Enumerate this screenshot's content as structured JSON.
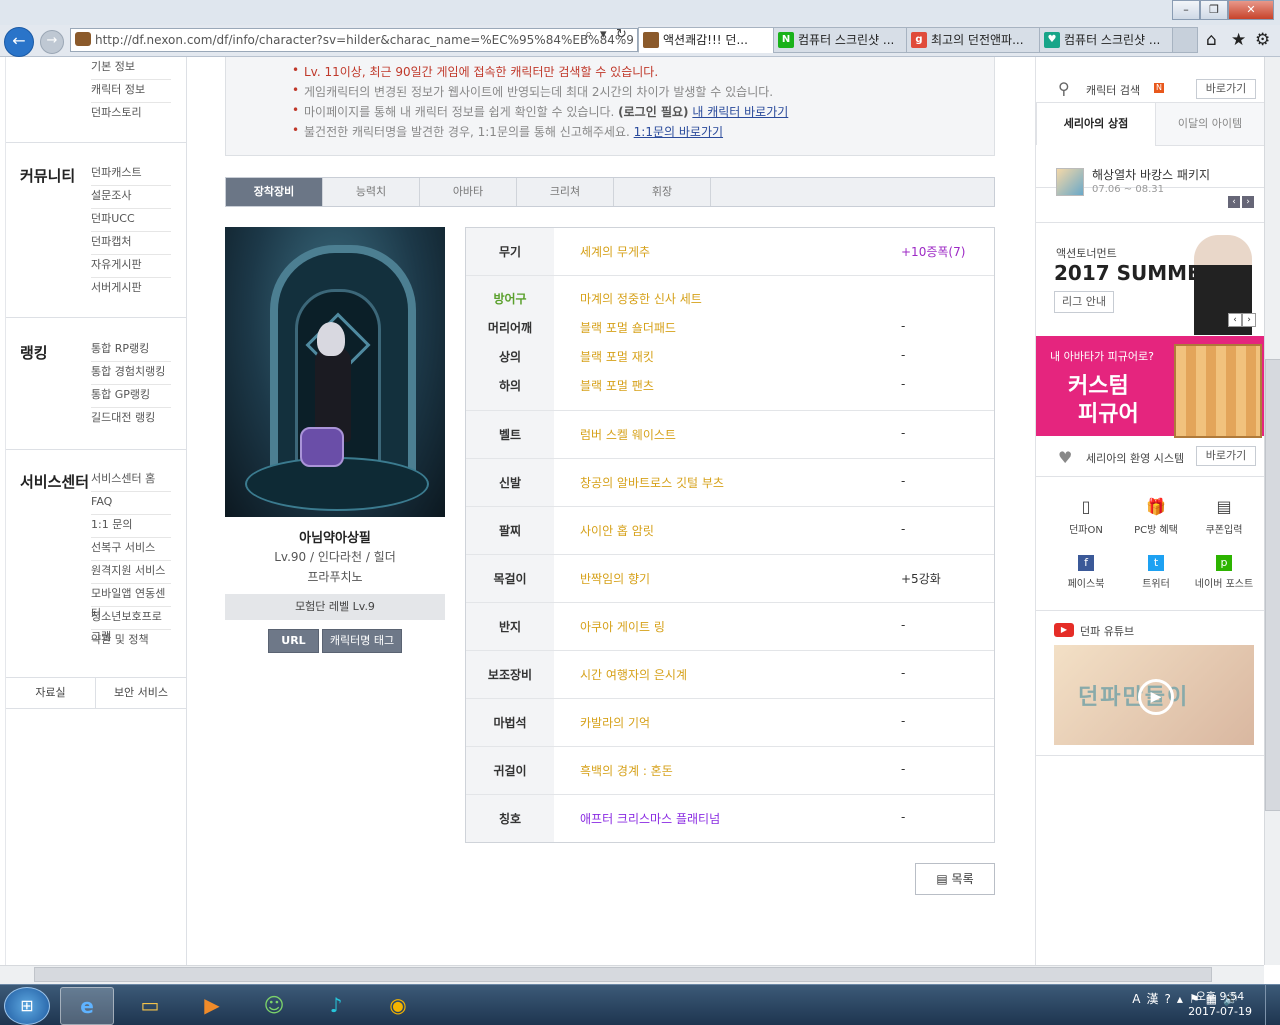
{
  "browser": {
    "address": "http://df.nexon.com/df/info/character?sv=hilder&charac_name=%EC%95%84%EB%84%9",
    "address_domain": "df.nexon.com",
    "tabs": [
      {
        "label": "액션쾌감!!! 던...",
        "icon_color": "#8b5a2b"
      },
      {
        "label": "컴퓨터 스크린샷 ...",
        "icon_color": "#19b21a",
        "icon_text": "N"
      },
      {
        "label": "최고의 던전앤파...",
        "icon_color": "#e04b3a",
        "icon_text": "g"
      },
      {
        "label": "컴퓨터 스크린샷 ...",
        "icon_color": "#17a589",
        "icon_text": "♥"
      }
    ]
  },
  "left_nav": {
    "top_links": [
      "기본 정보",
      "캐릭터 정보",
      "던파스토리"
    ],
    "groups": [
      {
        "title": "커뮤니티",
        "links": [
          "던파캐스트",
          "설문조사",
          "던파UCC",
          "던파캡처",
          "자유게시판",
          "서버게시판"
        ]
      },
      {
        "title": "랭킹",
        "links": [
          "통합 RP랭킹",
          "통합 경험치랭킹",
          "통합 GP랭킹",
          "길드대전 랭킹"
        ]
      },
      {
        "title": "서비스센터",
        "links": [
          "서비스센터 홈",
          "FAQ",
          "1:1 문의",
          "선복구 서비스",
          "원격지원 서비스",
          "모바일앱 연동센터",
          "청소년보호프로그램",
          "약관 및 정책"
        ]
      }
    ],
    "bottom": [
      "자료실",
      "보안 서비스"
    ]
  },
  "notice": {
    "line1": "Lv. 11이상, 최근 90일간 게임에 접속한 캐릭터만 검색할 수 있습니다.",
    "line2": "게임캐릭터의 변경된 정보가 웹사이트에 반영되는데 최대 2시간의 차이가 발생할 수 있습니다.",
    "line3_pre": "마이페이지를 통해 내 캐릭터 정보를 쉽게 확인할 수 있습니다. ",
    "line3_bold": "(로그인 필요)",
    "line3_link": "내 캐릭터 바로가기",
    "line4_pre": "불건전한 캐릭터명을 발견한 경우, 1:1문의를 통해 신고해주세요. ",
    "line4_link": "1:1문의 바로가기"
  },
  "char_tabs": [
    "장착장비",
    "능력치",
    "아바타",
    "크리쳐",
    "휘장"
  ],
  "character": {
    "name": "아님약아상필",
    "info": "Lv.90 / 인다라천 / 힐더",
    "guild": "프라푸치노",
    "adventure_level": "모험단 레벨 Lv.9",
    "btn_url": "URL",
    "btn_tag": "캐릭터명 태그"
  },
  "equipment": [
    {
      "slot": "무기",
      "item": "세계의 무게추",
      "opt": "+10증폭(7)",
      "opt_purple": true
    },
    {
      "slot": "방어구",
      "slot_green": true,
      "item": "마계의 정중한 신사 세트",
      "opt": ""
    },
    {
      "slot": "머리어깨",
      "item": "블랙 포멀 숄더패드",
      "opt": "-"
    },
    {
      "slot": "상의",
      "item": "블랙 포멀 재킷",
      "opt": "-"
    },
    {
      "slot": "하의",
      "item": "블랙 포멀 팬츠",
      "opt": "-"
    },
    {
      "slot": "벨트",
      "item": "럼버 스켈 웨이스트",
      "opt": "-"
    },
    {
      "slot": "신발",
      "item": "창공의 알바트로스 깃털 부츠",
      "opt": "-"
    },
    {
      "slot": "팔찌",
      "item": "사이안 홉 암릿",
      "opt": "-"
    },
    {
      "slot": "목걸이",
      "item": "반짝임의 향기",
      "opt": "+5강화"
    },
    {
      "slot": "반지",
      "item": "아쿠아 게이트 링",
      "opt": "-"
    },
    {
      "slot": "보조장비",
      "item": "시간 여행자의 은시계",
      "opt": "-"
    },
    {
      "slot": "마법석",
      "item": "카발라의 기억",
      "opt": "-"
    },
    {
      "slot": "귀걸이",
      "item": "흑백의 경계 : 혼돈",
      "opt": "-"
    },
    {
      "slot": "칭호",
      "item": "애프터 크리스마스 플래티넘",
      "opt": "-",
      "item_purple": true
    }
  ],
  "list_button": "목록",
  "right": {
    "char_search": "캐릭터 검색",
    "char_search_badge": "N",
    "go": "바로가기",
    "tab_active": "세리아의 상점",
    "tab_inactive": "이달의 아이템",
    "promo_title": "해상열차 바캉스 패키지",
    "promo_date": "07.06 ~ 08.31",
    "tour_small": "액션토너먼트",
    "tour_big": "2017 SUMMER",
    "tour_btn": "리그 안내",
    "banner_q": "내 아바타가 피규어로?",
    "banner_main1": "커스텀",
    "banner_main2": "피규어",
    "welcome": "세리아의 환영 시스템",
    "quick": [
      {
        "label": "던파ON",
        "icon": "phone-icon"
      },
      {
        "label": "PC방 혜택",
        "icon": "gift-icon"
      },
      {
        "label": "쿠폰입력",
        "icon": "coupon-icon"
      },
      {
        "label": "페이스북",
        "icon": "facebook-icon"
      },
      {
        "label": "트위터",
        "icon": "twitter-icon"
      },
      {
        "label": "네이버 포스트",
        "icon": "naver-post-icon"
      }
    ],
    "youtube": "던파 유튜브",
    "video_text": "던파만들이"
  },
  "taskbar": {
    "time": "오후 9:54",
    "date": "2017-07-19"
  }
}
